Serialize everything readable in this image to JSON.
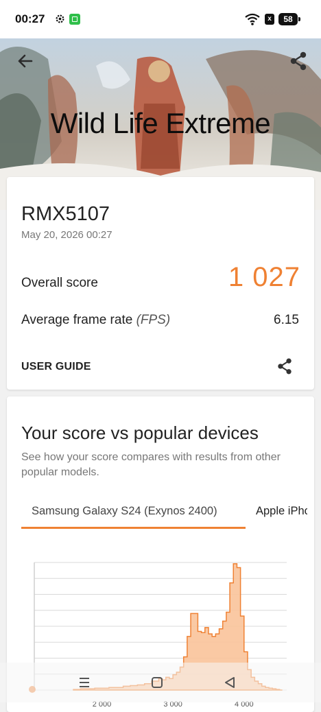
{
  "status_bar": {
    "time": "00:27",
    "sim_label": "x",
    "battery": "58"
  },
  "hero": {
    "title": "Wild Life Extreme",
    "back_icon": "arrow-left-icon",
    "share_icon": "share-icon"
  },
  "result": {
    "device": "RMX5107",
    "date": "May 20, 2026 00:27",
    "overall_label": "Overall score",
    "overall_value": "1 027",
    "fps_label": "Average frame rate",
    "fps_unit": "(FPS)",
    "fps_value": "6.15",
    "user_guide": "USER GUIDE",
    "accent_color": "#ef8133"
  },
  "compare": {
    "title": "Your score vs popular devices",
    "description": "See how your score compares with results from other popular models.",
    "tabs": [
      {
        "label": "Samsung Galaxy S24 (Exynos 2400)",
        "selected": true
      },
      {
        "label": "Apple iPhone",
        "selected": false
      }
    ]
  },
  "chart_data": {
    "type": "area",
    "x_ticks": [
      "2 000",
      "3 000",
      "4 000"
    ],
    "grid": true,
    "fill_color": "#f9c39a",
    "line_color": "#ef8133",
    "x": [
      1600,
      1700,
      1800,
      1900,
      2000,
      2100,
      2200,
      2300,
      2400,
      2500,
      2600,
      2700,
      2800,
      2850,
      2900,
      2950,
      3000,
      3050,
      3100,
      3150,
      3200,
      3250,
      3300,
      3350,
      3400,
      3450,
      3500,
      3550,
      3600,
      3650,
      3700,
      3750,
      3800,
      3850,
      3900,
      3950,
      4000,
      4050,
      4100,
      4150,
      4200,
      4250,
      4300,
      4350,
      4400,
      4450,
      4500
    ],
    "y": [
      0.5,
      1,
      1,
      1.5,
      1.5,
      2,
      2,
      3,
      3.5,
      4,
      5,
      7,
      9,
      8,
      10,
      9,
      12,
      14,
      18,
      26,
      42,
      60,
      60,
      46,
      45,
      49,
      44,
      42,
      44,
      48,
      54,
      61,
      84,
      99,
      96,
      58,
      30,
      16,
      10,
      7,
      5,
      3,
      2,
      1.5,
      1,
      0.5,
      0
    ],
    "ylim": [
      0,
      100
    ]
  },
  "nav": {
    "menu_icon": "menu-icon",
    "home_icon": "home-icon",
    "back_icon": "back-triangle-icon"
  }
}
